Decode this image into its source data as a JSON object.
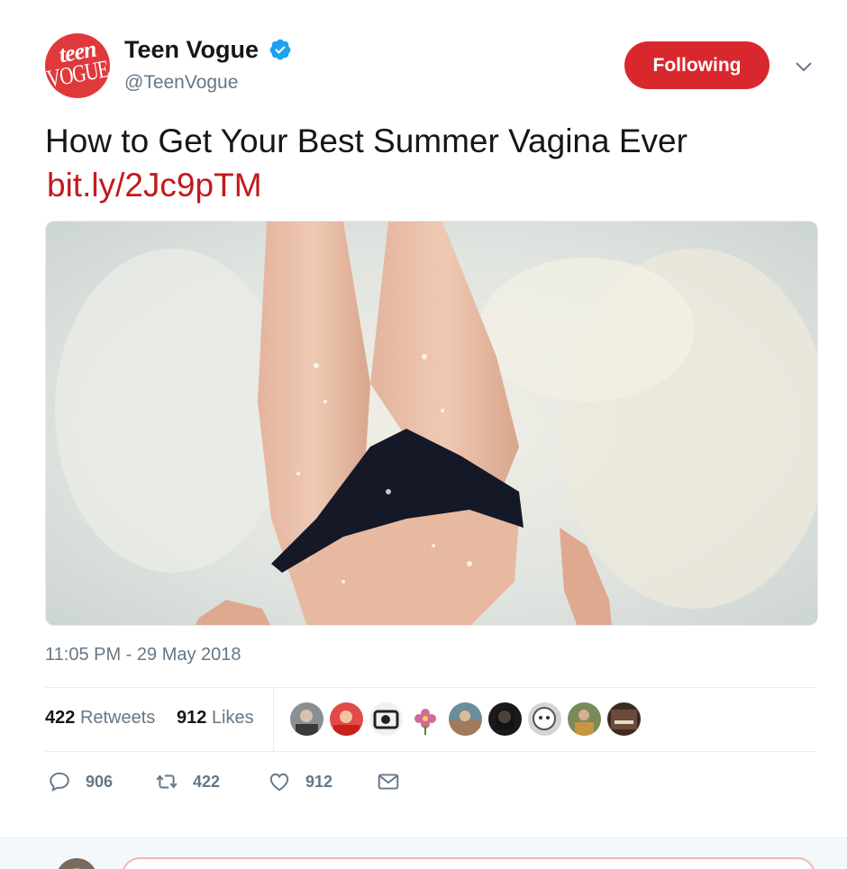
{
  "account": {
    "display_name": "Teen Vogue",
    "handle": "@TeenVogue",
    "avatar_logo_top": "teen",
    "avatar_logo_bottom": "VOGUE",
    "verified": true
  },
  "follow_button": {
    "label": "Following",
    "color": "#d9272e"
  },
  "tweet": {
    "text": "How to Get Your Best Summer Vagina Ever",
    "link": "bit.ly/2Jc9pTM",
    "link_color": "#c2191c",
    "media_description_icon": "photo",
    "timestamp": "11:05 PM - 29 May 2018"
  },
  "stats": {
    "retweets_count": "422",
    "retweets_label": "Retweets",
    "likes_count": "912",
    "likes_label": "Likes"
  },
  "liked_by_avatars": [
    {
      "name": "liker-avatar-1"
    },
    {
      "name": "liker-avatar-2"
    },
    {
      "name": "liker-avatar-3"
    },
    {
      "name": "liker-avatar-4"
    },
    {
      "name": "liker-avatar-5"
    },
    {
      "name": "liker-avatar-6"
    },
    {
      "name": "liker-avatar-7"
    },
    {
      "name": "liker-avatar-8"
    },
    {
      "name": "liker-avatar-9"
    }
  ],
  "actions": {
    "reply_count": "906",
    "retweet_count": "422",
    "like_count": "912"
  },
  "icons": {
    "verified": "verified-badge-icon",
    "caret": "chevron-down-icon",
    "reply": "reply-icon",
    "retweet": "retweet-icon",
    "like": "heart-icon",
    "dm": "envelope-icon"
  }
}
